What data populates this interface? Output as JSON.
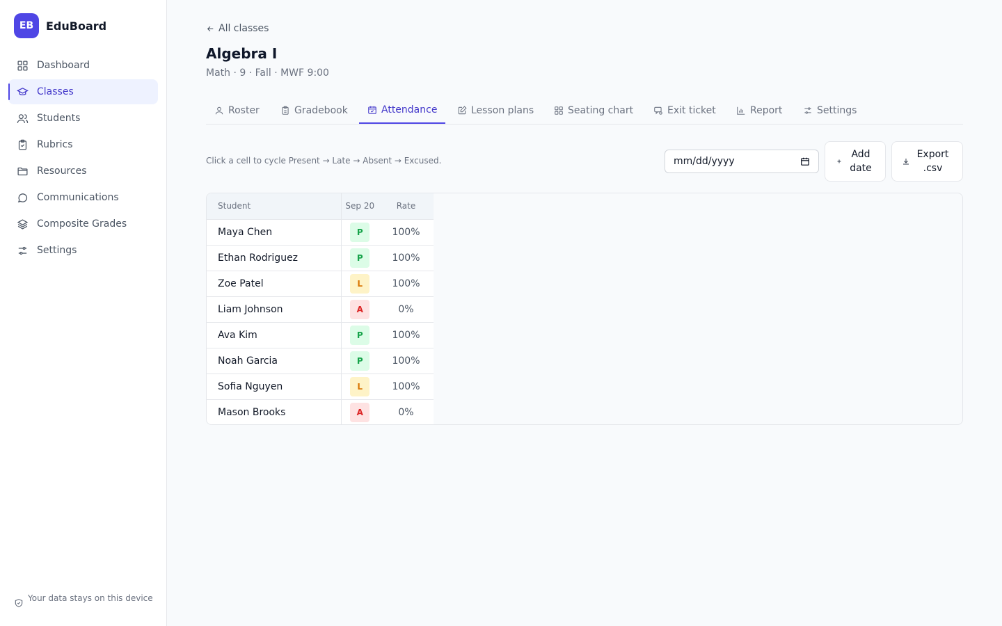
{
  "brand": {
    "logo_text": "EB",
    "name": "EduBoard"
  },
  "sidebar": {
    "items": [
      {
        "label": "Dashboard",
        "icon": "grid-icon",
        "active": false
      },
      {
        "label": "Classes",
        "icon": "graduation-cap-icon",
        "active": true
      },
      {
        "label": "Students",
        "icon": "users-icon",
        "active": false
      },
      {
        "label": "Rubrics",
        "icon": "clipboard-check-icon",
        "active": false
      },
      {
        "label": "Resources",
        "icon": "folder-icon",
        "active": false
      },
      {
        "label": "Communications",
        "icon": "message-icon",
        "active": false
      },
      {
        "label": "Composite Grades",
        "icon": "layers-icon",
        "active": false
      },
      {
        "label": "Settings",
        "icon": "sliders-icon",
        "active": false
      }
    ],
    "footer": "Your data stays on this device"
  },
  "header": {
    "back_label": "All classes",
    "title": "Algebra I",
    "subtitle": "Math · 9 · Fall · MWF 9:00"
  },
  "tabs": [
    {
      "label": "Roster",
      "icon": "user-icon",
      "active": false
    },
    {
      "label": "Gradebook",
      "icon": "clipboard-icon",
      "active": false
    },
    {
      "label": "Attendance",
      "icon": "calendar-check-icon",
      "active": true
    },
    {
      "label": "Lesson plans",
      "icon": "edit-icon",
      "active": false
    },
    {
      "label": "Seating chart",
      "icon": "grid-icon",
      "active": false
    },
    {
      "label": "Exit ticket",
      "icon": "ticket-icon",
      "active": false
    },
    {
      "label": "Report",
      "icon": "bar-chart-icon",
      "active": false
    },
    {
      "label": "Settings",
      "icon": "sliders-icon",
      "active": false
    }
  ],
  "attendance": {
    "hint": "Click a cell to cycle Present → Late → Absent → Excused.",
    "date_placeholder": "mm/dd/yyyy",
    "add_date_label": "Add date",
    "export_label": "Export .csv",
    "columns": {
      "student": "Student",
      "date": "Sep 20",
      "rate": "Rate"
    },
    "rows": [
      {
        "student": "Maya Chen",
        "status": "P",
        "rate": "100%"
      },
      {
        "student": "Ethan Rodriguez",
        "status": "P",
        "rate": "100%"
      },
      {
        "student": "Zoe Patel",
        "status": "L",
        "rate": "100%"
      },
      {
        "student": "Liam Johnson",
        "status": "A",
        "rate": "0%"
      },
      {
        "student": "Ava Kim",
        "status": "P",
        "rate": "100%"
      },
      {
        "student": "Noah Garcia",
        "status": "P",
        "rate": "100%"
      },
      {
        "student": "Sofia Nguyen",
        "status": "L",
        "rate": "100%"
      },
      {
        "student": "Mason Brooks",
        "status": "A",
        "rate": "0%"
      }
    ]
  },
  "colors": {
    "accent": "#4f46e5",
    "present": "#16a34a",
    "late": "#d97706",
    "absent": "#dc2626"
  }
}
